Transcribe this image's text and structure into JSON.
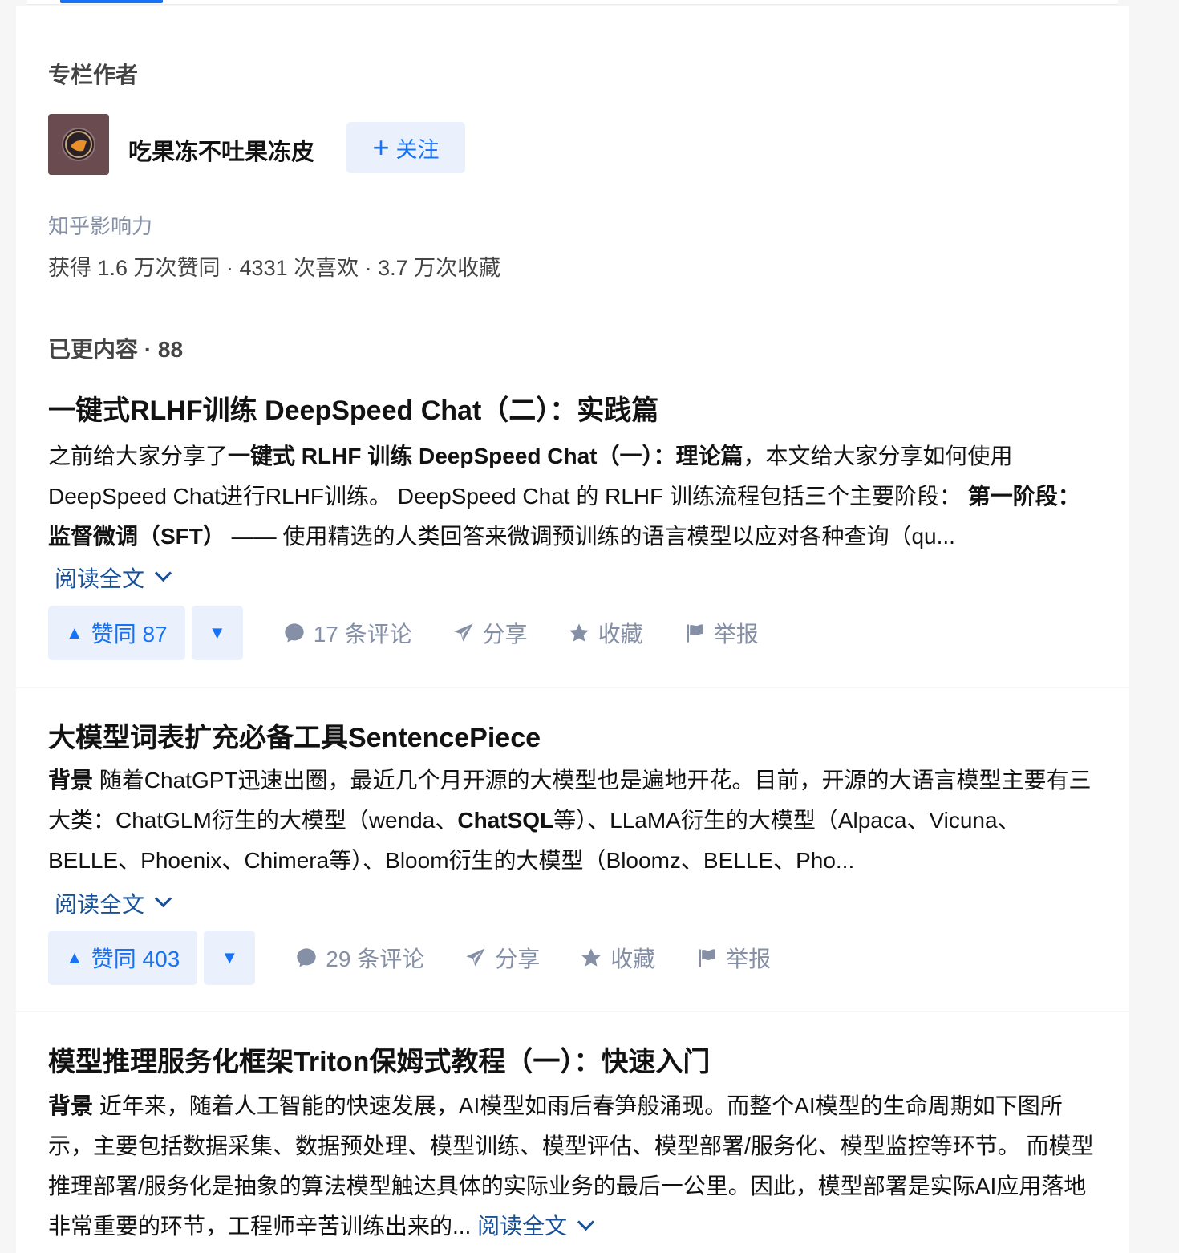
{
  "column": {
    "section_title": "专栏作者",
    "author_name": "吃果冻不吐果冻皮",
    "follow_label": "关注",
    "influence_label": "知乎影响力",
    "influence_stats": "获得 1.6 万次赞同 · 4331 次喜欢 · 3.7 万次收藏",
    "content_count_label": "已更内容 · 88"
  },
  "articles": [
    {
      "title": "一键式RLHF训练 DeepSpeed Chat（二）：实践篇",
      "excerpt": {
        "p1": "之前给大家分享了",
        "b1": "一键式 RLHF 训练 DeepSpeed Chat（一）：理论篇",
        "p2": "，本文给大家分享如何使用DeepSpeed Chat进行RLHF训练。 DeepSpeed Chat 的 RLHF 训练流程包括三个主要阶段： ",
        "b2": "第一阶段：监督微调（SFT）",
        "p3": " —— 使用精选的人类回答来微调预训练的语言模型以应对各种查询（qu..."
      },
      "read_more": "阅读全文",
      "upvote_label": "赞同 87",
      "comments_label": "17 条评论",
      "share_label": "分享",
      "favorite_label": "收藏",
      "report_label": "举报"
    },
    {
      "title": "大模型词表扩充必备工具SentencePiece",
      "excerpt": {
        "b1": "背景",
        "p1": " 随着ChatGPT迅速出圈，最近几个月开源的大模型也是遍地开花。目前，开源的大语言模型主要有三大类：ChatGLM衍生的大模型（wenda、",
        "link": "ChatSQL",
        "p2": "等）、LLaMA衍生的大模型（Alpaca、Vicuna、BELLE、Phoenix、Chimera等）、Bloom衍生的大模型（Bloomz、BELLE、Pho..."
      },
      "read_more": "阅读全文",
      "upvote_label": "赞同 403",
      "comments_label": "29 条评论",
      "share_label": "分享",
      "favorite_label": "收藏",
      "report_label": "举报"
    },
    {
      "title": "模型推理服务化框架Triton保姆式教程（一）：快速入门",
      "excerpt": {
        "b1": "背景",
        "p1": " 近年来，随着人工智能的快速发展，AI模型如雨后春笋般涌现。而整个AI模型的生命周期如下图所示，主要包括数据采集、数据预处理、模型训练、模型评估、模型部署/服务化、模型监控等环节。 而模型推理部署/服务化是抽象的算法模型触达具体的实际业务的最后一公里。因此，模型部署是实际AI应用落地非常重要的环节，工程师辛苦训练出来的... "
      },
      "read_more": "阅读全文"
    }
  ]
}
